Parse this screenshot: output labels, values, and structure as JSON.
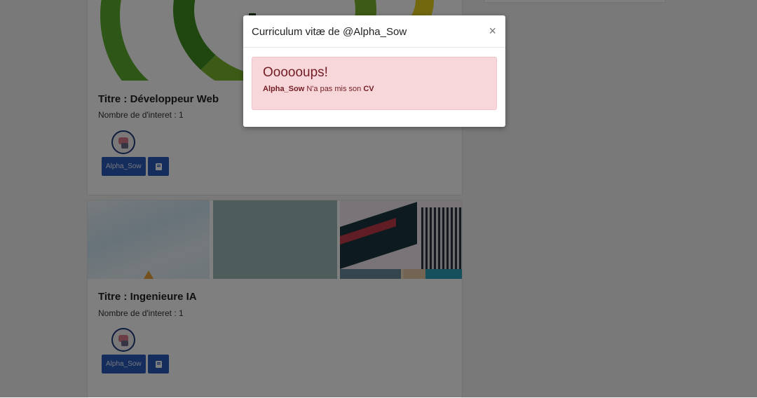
{
  "cards": [
    {
      "title": "Titre : Développeur Web",
      "interest": "Nombre de d'interet : 1",
      "user_button": "Alpha_Sow"
    },
    {
      "title": "Titre : Ingenieure IA",
      "interest": "Nombre de d'interet : 1",
      "user_button": "Alpha_Sow"
    }
  ],
  "modal": {
    "title": "Curriculum vitæ de @Alpha_Sow",
    "close": "×",
    "alert_heading": "Oooooups!",
    "alert_user": "Alpha_Sow",
    "alert_middle": " N'a pas mis son ",
    "alert_cv": "CV"
  },
  "icons": {
    "book": "book-icon",
    "close": "close-icon"
  },
  "colors": {
    "primary_button": "#2a5bb8",
    "alert_background": "#f8d7da",
    "alert_text": "#721c24",
    "backdrop": "rgba(0,0,0,0.5)"
  }
}
